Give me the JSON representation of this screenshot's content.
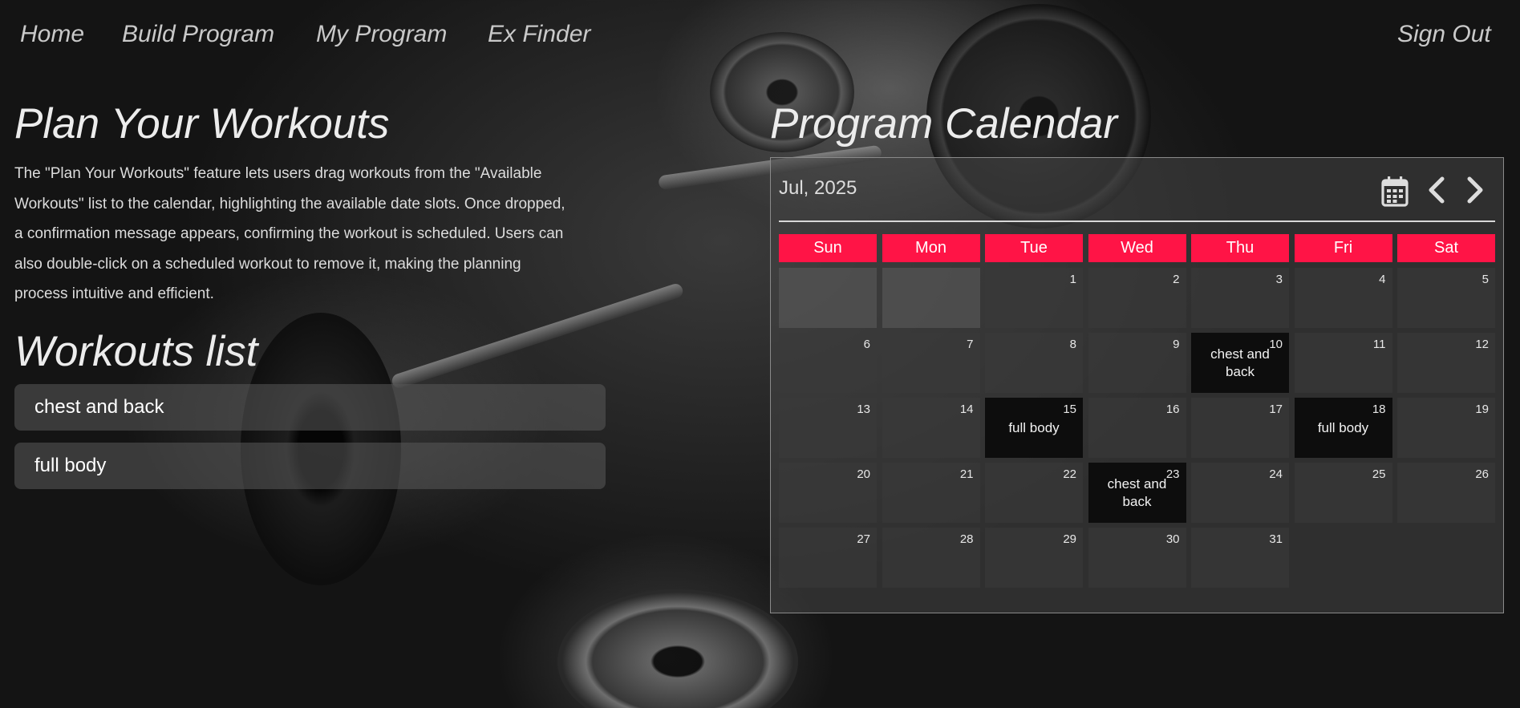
{
  "nav": {
    "home": "Home",
    "build": "Build Program",
    "my_program": "My Program",
    "ex_finder": "Ex Finder",
    "sign_out": "Sign Out"
  },
  "intro": {
    "title": "Plan Your Workouts",
    "description": "The \"Plan Your Workouts\" feature lets users drag workouts from the \"Available Workouts\" list to the calendar, highlighting the available date slots. Once dropped, a confirmation message appears, confirming the workout is scheduled. Users can also double-click on a scheduled workout to remove it, making the planning process intuitive and efficient."
  },
  "workouts": {
    "title": "Workouts list",
    "items": [
      "chest and back",
      "full body"
    ]
  },
  "calendar": {
    "title": "Program Calendar",
    "month_label": "Jul, 2025",
    "weekdays": [
      "Sun",
      "Mon",
      "Tue",
      "Wed",
      "Thu",
      "Fri",
      "Sat"
    ],
    "accent_color": "#ff1446",
    "icons": {
      "calendar": "calendar-icon",
      "prev": "chevron-left-icon",
      "next": "chevron-right-icon"
    },
    "events": {
      "10": "chest and back",
      "15": "full body",
      "18": "full body",
      "23": "chest and back"
    }
  }
}
